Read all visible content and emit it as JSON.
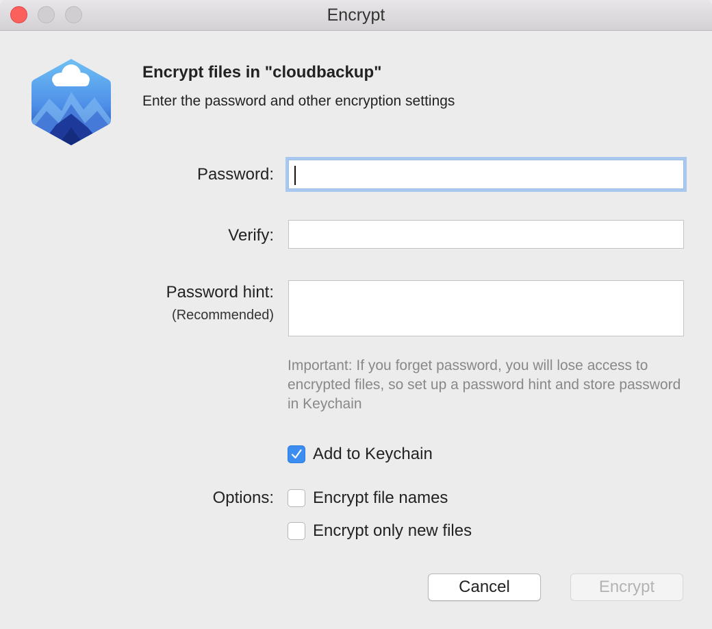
{
  "window": {
    "title": "Encrypt"
  },
  "header": {
    "title": "Encrypt files in \"cloudbackup\"",
    "subtitle": "Enter the password and other encryption settings",
    "app_icon": "cloudmounter-icon"
  },
  "form": {
    "password_label": "Password:",
    "password_value": "",
    "verify_label": "Verify:",
    "verify_value": "",
    "hint_label": "Password hint:",
    "hint_sublabel": "(Recommended)",
    "hint_value": "",
    "note": "Important: If you forget password, you will lose access to encrypted files, so set up a password hint and store password in Keychain",
    "keychain": {
      "label": "Add to Keychain",
      "checked": true
    },
    "options_label": "Options:",
    "options": [
      {
        "label": "Encrypt file names",
        "checked": false
      },
      {
        "label": "Encrypt only new files",
        "checked": false
      }
    ]
  },
  "buttons": {
    "cancel": "Cancel",
    "encrypt": "Encrypt",
    "encrypt_enabled": false
  },
  "colors": {
    "accent": "#3b8df0",
    "focus_ring": "#a9c8ef",
    "close_button": "#fc605c"
  }
}
